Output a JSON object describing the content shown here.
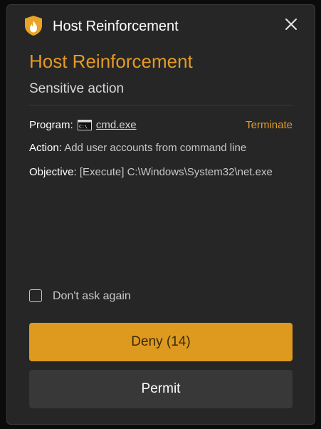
{
  "window": {
    "title": "Host Reinforcement",
    "icon": "flame-shield-icon"
  },
  "header": {
    "heading": "Host Reinforcement",
    "subheading": "Sensitive action"
  },
  "details": {
    "program_label": "Program:",
    "program_icon": "cmd-console-icon",
    "program_value": "cmd.exe",
    "terminate_label": "Terminate",
    "action_label": "Action:",
    "action_value": "Add user accounts from command line",
    "objective_label": "Objective:",
    "objective_value": "[Execute] C:\\Windows\\System32\\net.exe"
  },
  "options": {
    "dont_ask_label": "Don't ask again",
    "dont_ask_checked": false
  },
  "buttons": {
    "deny_label": "Deny (14)",
    "permit_label": "Permit"
  },
  "colors": {
    "accent": "#e49a25",
    "deny_bg": "#de9a1f",
    "window_bg": "#262626",
    "permit_bg": "#383838"
  }
}
